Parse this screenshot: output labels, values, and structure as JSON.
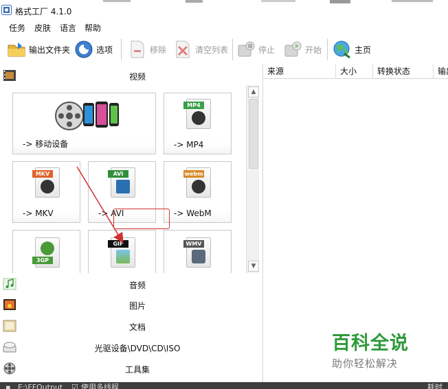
{
  "window": {
    "title": "格式工厂 4.1.0"
  },
  "menu": [
    "任务",
    "皮肤",
    "语言",
    "帮助"
  ],
  "toolbar": {
    "output_folder": "输出文件夹",
    "options": "选项",
    "remove": "移除",
    "clear_list": "清空列表",
    "stop": "停止",
    "start": "开始",
    "home": "主页"
  },
  "categories": {
    "video": "视频",
    "audio": "音频",
    "picture": "图片",
    "document": "文档",
    "disc": "光驱设备\\DVD\\CD\\ISO",
    "tools": "工具集"
  },
  "tiles": [
    {
      "label": "-> 移动设备"
    },
    {
      "label": "-> MP4",
      "tag": "MP4",
      "tag_color": "#3aa04a"
    },
    {
      "label": "-> MKV",
      "tag": "MKV",
      "tag_color": "#e0632a"
    },
    {
      "label": "-> AVI",
      "tag": "AVI",
      "tag_color": "#2f8f3a"
    },
    {
      "label": "-> WebM",
      "tag": "webm",
      "tag_color": "#d98a2a"
    },
    {
      "label": "",
      "tag": "3GP",
      "tag_color": "#4a9a3a"
    },
    {
      "label": "",
      "tag": "GIF",
      "tag_color": "#111111"
    },
    {
      "label": "",
      "tag": "WMV",
      "tag_color": "#555555"
    }
  ],
  "task_list": {
    "columns": [
      "来源",
      "大小",
      "转换状态",
      "输出"
    ]
  },
  "watermark": {
    "line1": "百科全说",
    "line2": "助你轻松解决"
  },
  "status": {
    "output_path": "E:\\FFOutput",
    "multithread": "使用多线程",
    "elapsed": "耗时"
  },
  "colors": {
    "accent_red": "#d03030",
    "watermark_green": "#2e9a3a"
  }
}
